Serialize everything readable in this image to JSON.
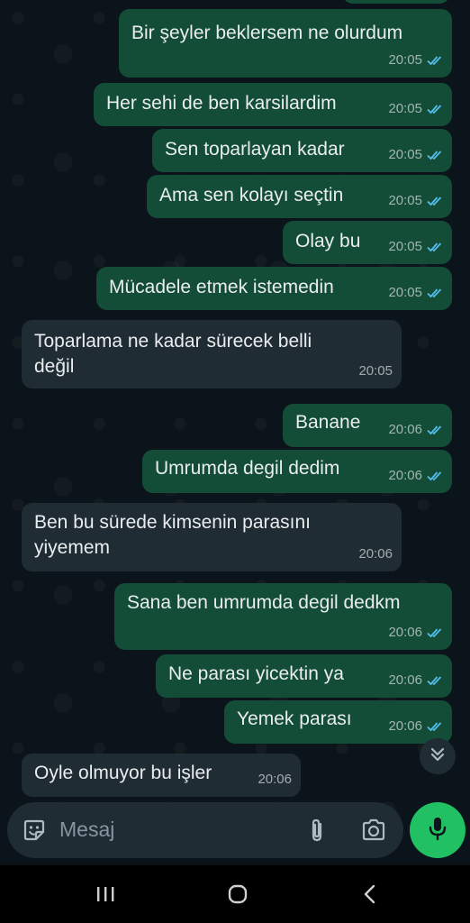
{
  "messages": [
    {
      "text": "Bir şeyler beklersem ne olurdum",
      "time": "20:05",
      "dir": "out"
    },
    {
      "text": "Her sehi de ben karsilardim",
      "time": "20:05",
      "dir": "out"
    },
    {
      "text": "Sen toparlayan kadar",
      "time": "20:05",
      "dir": "out"
    },
    {
      "text": "Ama sen kolayı seçtin",
      "time": "20:05",
      "dir": "out"
    },
    {
      "text": "Olay bu",
      "time": "20:05",
      "dir": "out"
    },
    {
      "text": "Mücadele etmek istemedin",
      "time": "20:05",
      "dir": "out"
    },
    {
      "line1": "Toparlama ne kadar sürecek belli",
      "line2": "değil",
      "time": "20:05",
      "dir": "in"
    },
    {
      "text": "Banane",
      "time": "20:06",
      "dir": "out"
    },
    {
      "text": "Umrumda degil dedim",
      "time": "20:06",
      "dir": "out"
    },
    {
      "line1": "Ben bu sürede kimsenin parasını",
      "line2": "yiyemem",
      "time": "20:06",
      "dir": "in"
    },
    {
      "text": "Sana ben umrumda degil dedkm",
      "time": "20:06",
      "dir": "out"
    },
    {
      "text": "Ne parası yicektin ya",
      "time": "20:06",
      "dir": "out"
    },
    {
      "text": "Yemek parası",
      "time": "20:06",
      "dir": "out"
    },
    {
      "text": "Oyle olmuyor bu işler",
      "time": "20:06",
      "dir": "in"
    }
  ],
  "input": {
    "placeholder": "Mesaj"
  },
  "icons": {
    "emoji": "sticker-emoji-icon",
    "attach": "paperclip-icon",
    "camera": "camera-icon",
    "mic": "microphone-icon",
    "scroll": "double-chevron-down-icon",
    "read_receipt": "double-check-icon"
  },
  "colors": {
    "outgoing_bubble": "#144d37",
    "incoming_bubble": "#202c33",
    "read_tick": "#53bdeb",
    "mic_button": "#21c063",
    "chat_background": "#0b141a"
  }
}
